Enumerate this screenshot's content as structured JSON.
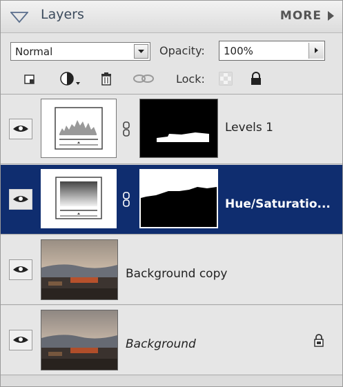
{
  "panel": {
    "title": "Layers",
    "more_label": "MORE"
  },
  "options": {
    "blend_mode": "Normal",
    "opacity_label": "Opacity:",
    "opacity_value": "100%",
    "lock_label": "Lock:",
    "tools": [
      "new-layer-icon",
      "adjustment-layer-icon",
      "trash-icon",
      "link-icon"
    ],
    "lock_icons": [
      "lock-transparent-icon",
      "lock-all-icon"
    ]
  },
  "layers": [
    {
      "name": "Levels 1",
      "type": "adjustment-levels",
      "visible": true,
      "selected": false,
      "has_mask": true
    },
    {
      "name": "Hue/Saturatio...",
      "type": "adjustment-hue-saturation",
      "visible": true,
      "selected": true,
      "has_mask": true
    },
    {
      "name": "Background copy",
      "type": "image",
      "visible": true,
      "selected": false,
      "has_mask": false
    },
    {
      "name": "Background",
      "type": "image",
      "visible": true,
      "selected": false,
      "has_mask": false,
      "locked": true,
      "italic": true
    }
  ],
  "colors": {
    "selection": "#0f2d6f",
    "panel_bg": "#e6e6e6"
  }
}
